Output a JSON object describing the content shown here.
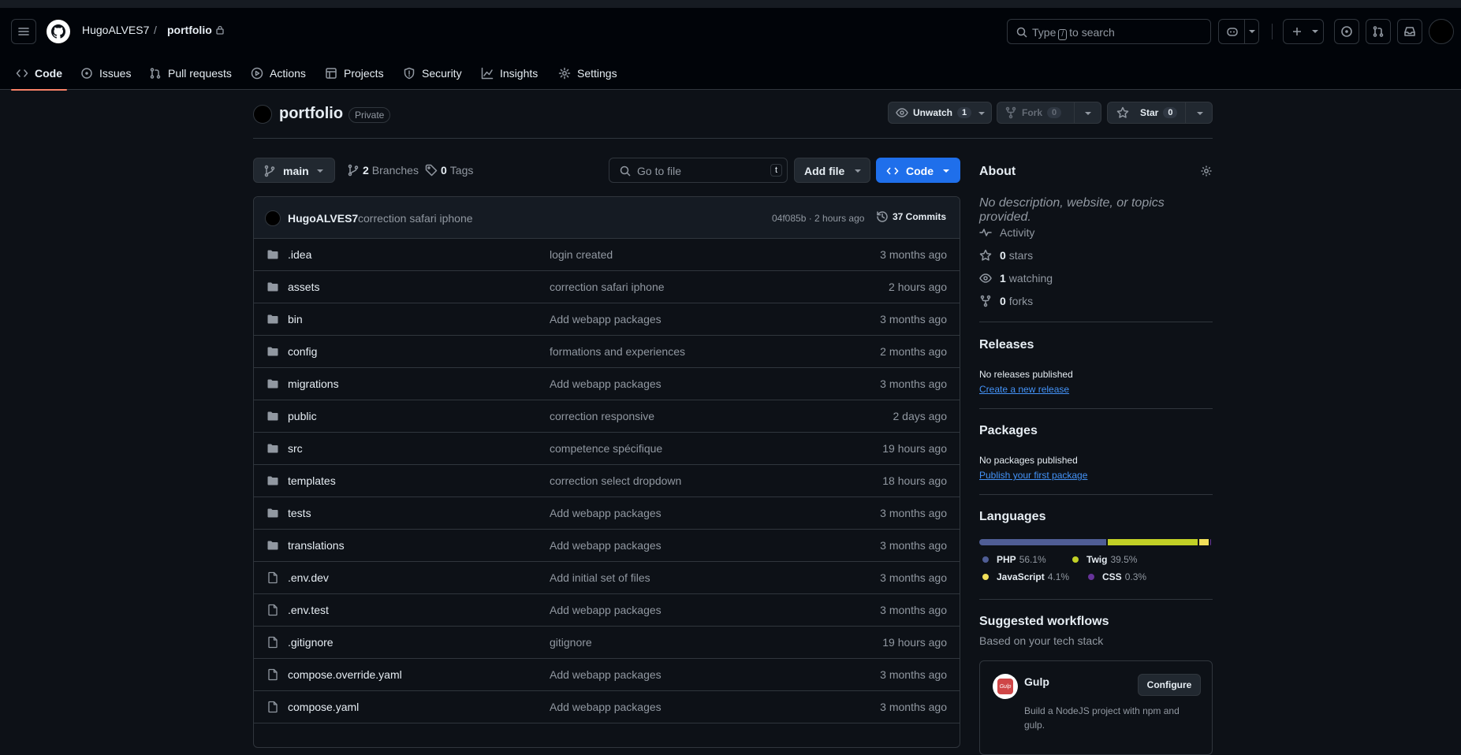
{
  "header": {
    "owner": "HugoALVES7",
    "separator": "/",
    "repo": "portfolio",
    "search_prefix": "Type",
    "search_key": "/",
    "search_suffix": "to search"
  },
  "tabs": [
    {
      "label": "Code",
      "icon": "code-icon"
    },
    {
      "label": "Issues",
      "icon": "issue-icon"
    },
    {
      "label": "Pull requests",
      "icon": "pull-request-icon"
    },
    {
      "label": "Actions",
      "icon": "play-icon"
    },
    {
      "label": "Projects",
      "icon": "table-icon"
    },
    {
      "label": "Security",
      "icon": "shield-icon"
    },
    {
      "label": "Insights",
      "icon": "graph-icon"
    },
    {
      "label": "Settings",
      "icon": "gear-icon"
    }
  ],
  "repohead": {
    "name": "portfolio",
    "visibility": "Private",
    "unwatch_label": "Unwatch",
    "watch_count": "1",
    "fork_label": "Fork",
    "fork_count": "0",
    "star_label": "Star",
    "star_count": "0"
  },
  "filenav": {
    "branch": "main",
    "branches_count": "2",
    "branches_label": "Branches",
    "tags_count": "0",
    "tags_label": "Tags",
    "goto_placeholder": "Go to file",
    "goto_key": "t",
    "add_file_label": "Add file",
    "code_label": "Code"
  },
  "latest_commit": {
    "author": "HugoALVES7",
    "message": "correction safari iphone",
    "meta": "04f085b · 2 hours ago",
    "commits_label": "37 Commits"
  },
  "files": [
    {
      "type": "folder",
      "name": ".idea",
      "message": "login created",
      "date": "3 months ago"
    },
    {
      "type": "folder",
      "name": "assets",
      "message": "correction safari iphone",
      "date": "2 hours ago"
    },
    {
      "type": "folder",
      "name": "bin",
      "message": "Add webapp packages",
      "date": "3 months ago"
    },
    {
      "type": "folder",
      "name": "config",
      "message": "formations and experiences",
      "date": "2 months ago"
    },
    {
      "type": "folder",
      "name": "migrations",
      "message": "Add webapp packages",
      "date": "3 months ago"
    },
    {
      "type": "folder",
      "name": "public",
      "message": "correction responsive",
      "date": "2 days ago"
    },
    {
      "type": "folder",
      "name": "src",
      "message": "competence spécifique",
      "date": "19 hours ago"
    },
    {
      "type": "folder",
      "name": "templates",
      "message": "correction select dropdown",
      "date": "18 hours ago"
    },
    {
      "type": "folder",
      "name": "tests",
      "message": "Add webapp packages",
      "date": "3 months ago"
    },
    {
      "type": "folder",
      "name": "translations",
      "message": "Add webapp packages",
      "date": "3 months ago"
    },
    {
      "type": "file",
      "name": ".env.dev",
      "message": "Add initial set of files",
      "date": "3 months ago"
    },
    {
      "type": "file",
      "name": ".env.test",
      "message": "Add webapp packages",
      "date": "3 months ago"
    },
    {
      "type": "file",
      "name": ".gitignore",
      "message": "gitignore",
      "date": "19 hours ago"
    },
    {
      "type": "file",
      "name": "compose.override.yaml",
      "message": "Add webapp packages",
      "date": "3 months ago"
    },
    {
      "type": "file",
      "name": "compose.yaml",
      "message": "Add webapp packages",
      "date": "3 months ago"
    }
  ],
  "about": {
    "title": "About",
    "description": "No description, website, or topics provided.",
    "activity": "Activity",
    "stars_count": "0",
    "stars_label": "stars",
    "watching_count": "1",
    "watching_label": "watching",
    "forks_count": "0",
    "forks_label": "forks"
  },
  "releases": {
    "title": "Releases",
    "empty": "No releases published",
    "link": "Create a new release"
  },
  "packages": {
    "title": "Packages",
    "empty": "No packages published",
    "link": "Publish your first package"
  },
  "languages": {
    "title": "Languages",
    "items": [
      {
        "name": "PHP",
        "pct": "56.1%",
        "value": 56.1,
        "color": "#4F5D95"
      },
      {
        "name": "Twig",
        "pct": "39.5%",
        "value": 39.5,
        "color": "#c1d026"
      },
      {
        "name": "JavaScript",
        "pct": "4.1%",
        "value": 4.1,
        "color": "#f1e05a"
      },
      {
        "name": "CSS",
        "pct": "0.3%",
        "value": 0.3,
        "color": "#663399"
      }
    ]
  },
  "workflows": {
    "title": "Suggested workflows",
    "subtitle": "Based on your tech stack",
    "card": {
      "name": "Gulp",
      "description": "Build a NodeJS project with npm and gulp.",
      "button": "Configure",
      "logo_text": "Gulp"
    }
  }
}
